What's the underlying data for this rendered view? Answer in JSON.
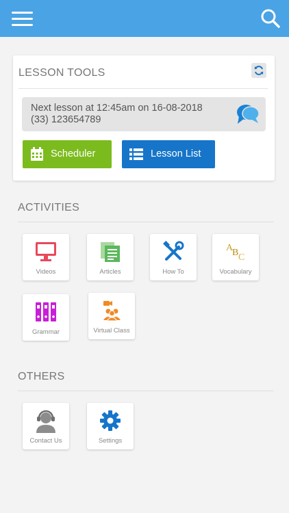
{
  "header": {
    "menu_icon": "hamburger-menu-icon",
    "search_icon": "search-icon",
    "bar_color": "#4aa3e4"
  },
  "lesson_tools": {
    "title": "LESSON TOOLS",
    "refresh_icon": "refresh-icon",
    "next_lesson_line1": "Next lesson at 12:45am on 16-08-2018",
    "next_lesson_line2": "(33) 123654789",
    "chat_icon": "chat-bubble-icon",
    "scheduler_label": "Scheduler",
    "lesson_list_label": "Lesson List",
    "scheduler_color": "#7cbb1e",
    "lesson_list_color": "#1675c9"
  },
  "activities": {
    "title": "ACTIVITIES",
    "items": [
      {
        "label": "Videos",
        "icon": "monitor-icon",
        "color": "#e8485a"
      },
      {
        "label": "Articles",
        "icon": "documents-icon",
        "color": "#5cb85c"
      },
      {
        "label": "How To",
        "icon": "tools-icon",
        "color": "#1675c9"
      },
      {
        "label": "Vocabulary",
        "icon": "abc-icon",
        "color": "#c9a227"
      },
      {
        "label": "Grammar",
        "icon": "binders-icon",
        "color": "#c81fd8"
      },
      {
        "label": "Virtual Class",
        "icon": "group-video-icon",
        "color": "#f08a24"
      }
    ]
  },
  "others": {
    "title": "OTHERS",
    "items": [
      {
        "label": "Contact Us",
        "icon": "support-agent-icon",
        "color": "#8c8c8c"
      },
      {
        "label": "Settings",
        "icon": "gear-icon",
        "color": "#1675c9"
      }
    ]
  }
}
